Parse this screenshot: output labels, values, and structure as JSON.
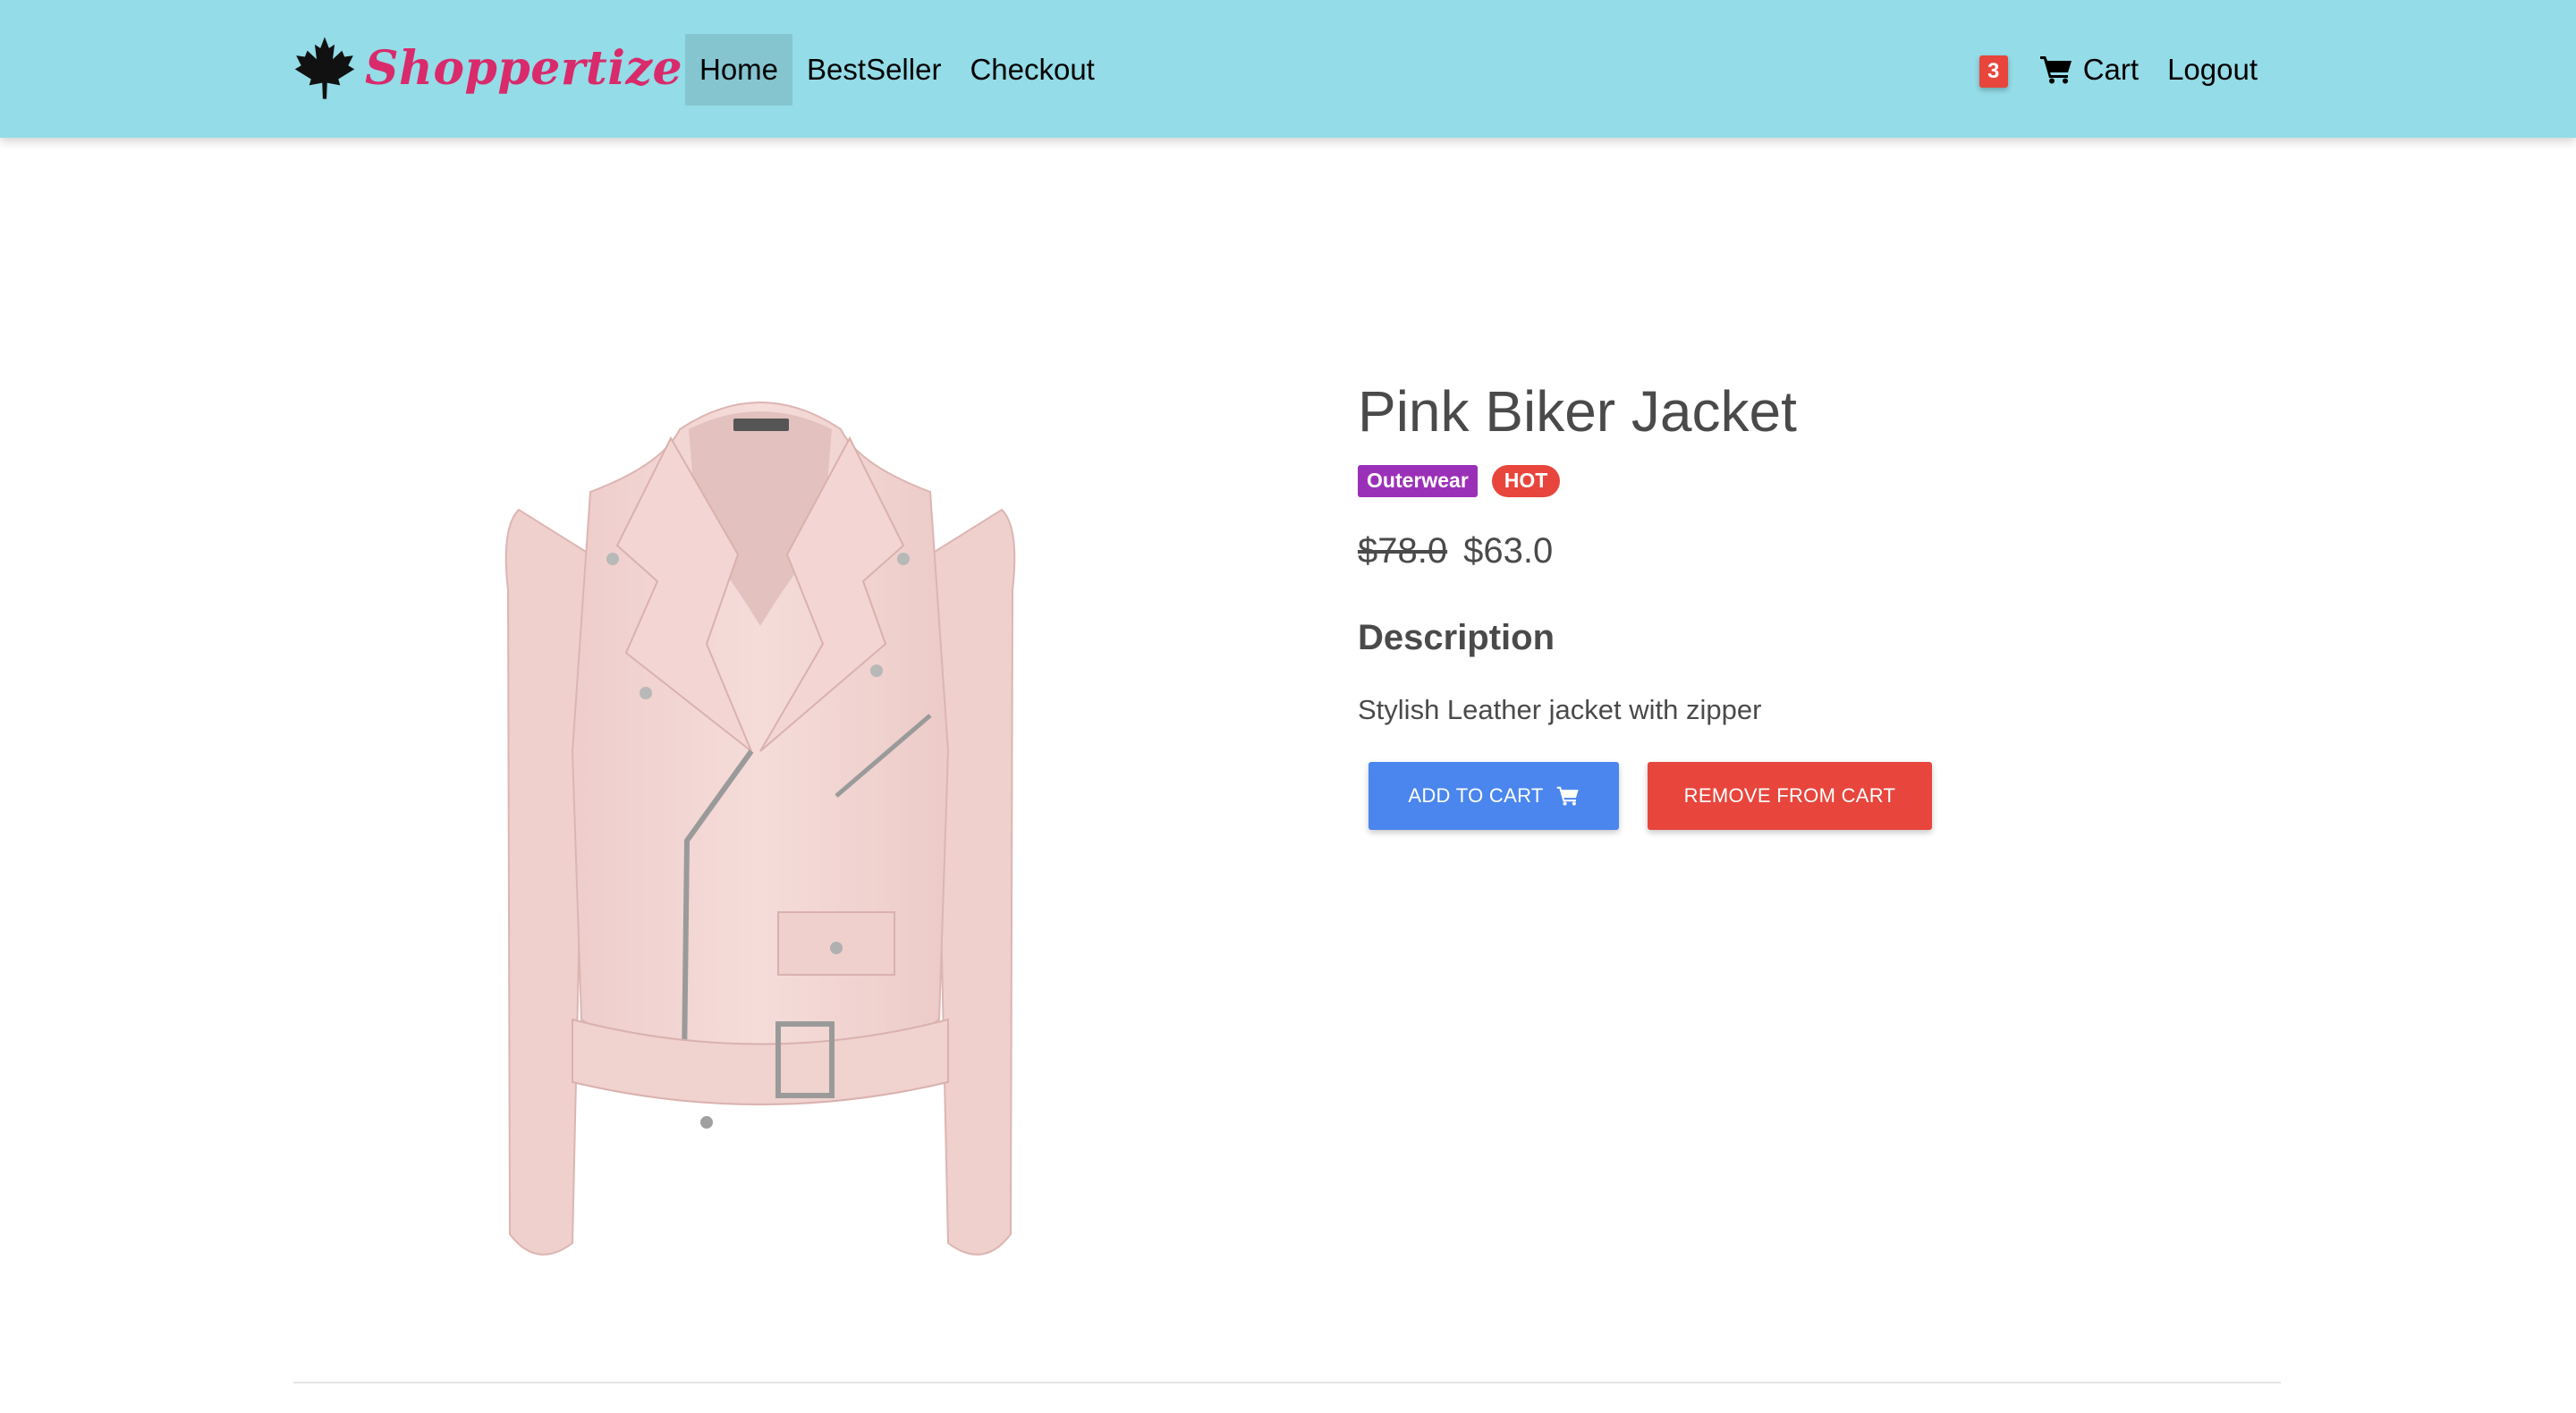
{
  "navbar": {
    "brand_name": "Shoppertize",
    "brand_icon": "maple-leaf-icon",
    "links": [
      "Home",
      "BestSeller",
      "Checkout"
    ],
    "cart_count": "3",
    "cart_label": "Cart",
    "logout_label": "Logout",
    "background_color": "#94dce7",
    "brand_color": "#d92a6b"
  },
  "product": {
    "title": "Pink Biker Jacket",
    "category_tag": "Outerwear",
    "hot_tag": "HOT",
    "original_price": "$78.0",
    "sale_price": "$63.0",
    "description_heading": "Description",
    "description": "Stylish Leather jacket with zipper",
    "image_alt": "pink leather biker jacket"
  },
  "actions": {
    "add_to_cart_label": "ADD TO CART",
    "remove_from_cart_label": "REMOVE FROM CART",
    "add_color": "#4b86ee",
    "remove_color": "#e8453c"
  }
}
